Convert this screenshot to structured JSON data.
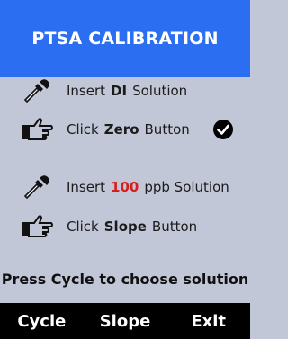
{
  "header": {
    "title": "PTSA CALIBRATION"
  },
  "steps": [
    {
      "icon": "dropper-icon",
      "prefix": "Insert",
      "highlight": "DI",
      "suffix": "Solution"
    },
    {
      "icon": "pointing-hand-icon",
      "prefix": "Click",
      "highlight": "Zero",
      "suffix": "Button",
      "done": true
    },
    {
      "icon": "dropper-icon",
      "prefix": "Insert",
      "highlight": "100",
      "suffix": "ppb Solution",
      "highlight_color": "#d61f1f"
    },
    {
      "icon": "pointing-hand-icon",
      "prefix": "Click",
      "highlight": "Slope",
      "suffix": "Button"
    }
  ],
  "hint": "Press Cycle to choose solution",
  "softkeys": {
    "cycle": "Cycle",
    "slope": "Slope",
    "exit": "Exit"
  },
  "colors": {
    "header_bg": "#2c6ef2",
    "screen_bg": "#c2c7d8",
    "softkey_bg": "#000000",
    "accent_red": "#d61f1f"
  }
}
